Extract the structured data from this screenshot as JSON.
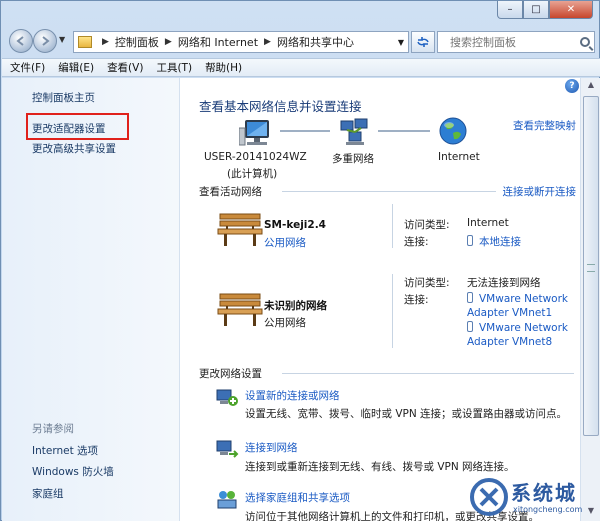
{
  "window": {
    "caption": {
      "minimize": "–",
      "maximize": "□",
      "close": "✕"
    }
  },
  "address": {
    "crumbs": [
      "控制面板",
      "网络和 Internet",
      "网络和共享中心"
    ],
    "search_placeholder": "搜索控制面板"
  },
  "menu": [
    "文件(F)",
    "编辑(E)",
    "查看(V)",
    "工具(T)",
    "帮助(H)"
  ],
  "sidebar": {
    "home": "控制面板主页",
    "links": [
      "更改适配器设置",
      "更改高级共享设置"
    ],
    "see_also_title": "另请参阅",
    "see_also": [
      "Internet 选项",
      "Windows 防火墙",
      "家庭组"
    ]
  },
  "main": {
    "title": "查看基本网络信息并设置连接",
    "view_full_map": "查看完整映射",
    "nodes": [
      {
        "label": "USER-20141024WZ",
        "sub": "(此计算机)"
      },
      {
        "label": "多重网络"
      },
      {
        "label": "Internet"
      }
    ],
    "active_header": "查看活动网络",
    "connect_disconnect": "连接或断开连接",
    "access_type_label": "访问类型:",
    "connection_label": "连接:",
    "networks": [
      {
        "name": "SM-keji2.4",
        "type": "公用网络",
        "access": "Internet",
        "connections": [
          "本地连接"
        ]
      },
      {
        "name": "未识别的网络",
        "type": "公用网络",
        "access": "无法连接到网络",
        "connections": [
          "VMware Network",
          "Adapter VMnet1",
          "VMware Network",
          "Adapter VMnet8"
        ]
      }
    ],
    "change_header": "更改网络设置",
    "tasks": [
      {
        "link": "设置新的连接或网络",
        "desc": "设置无线、宽带、拨号、临时或 VPN 连接；或设置路由器或访问点。"
      },
      {
        "link": "连接到网络",
        "desc": "连接到或重新连接到无线、有线、拨号或 VPN 网络连接。"
      },
      {
        "link": "选择家庭组和共享选项",
        "desc": "访问位于其他网络计算机上的文件和打印机，或更改共享设置。"
      }
    ]
  },
  "watermark": {
    "brand": "系统城",
    "url": "xitongcheng.com"
  },
  "colors": {
    "link": "#1b5bc4",
    "title": "#1a3c78",
    "highlight": "#e0211b"
  }
}
